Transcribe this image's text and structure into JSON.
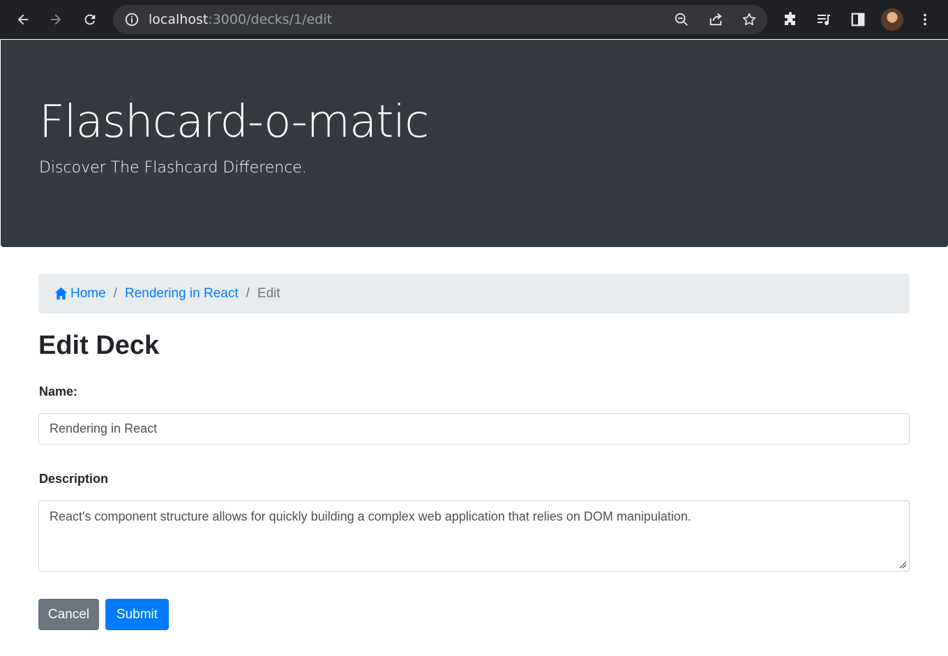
{
  "browser": {
    "url_host": "localhost",
    "url_path": ":3000/decks/1/edit"
  },
  "header": {
    "title": "Flashcard-o-matic",
    "subtitle": "Discover The Flashcard Difference."
  },
  "breadcrumb": {
    "home": "Home",
    "deck": "Rendering in React",
    "separator": "/",
    "current": "Edit"
  },
  "form": {
    "heading": "Edit Deck",
    "name_label": "Name:",
    "name_value": "Rendering in React",
    "description_label": "Description",
    "description_value": "React's component structure allows for quickly building a complex web application that relies on DOM manipulation.",
    "cancel_label": "Cancel",
    "submit_label": "Submit"
  },
  "colors": {
    "jumbotron": "#343a40",
    "link": "#007bff",
    "cancel": "#6c757d",
    "submit": "#007bff"
  }
}
